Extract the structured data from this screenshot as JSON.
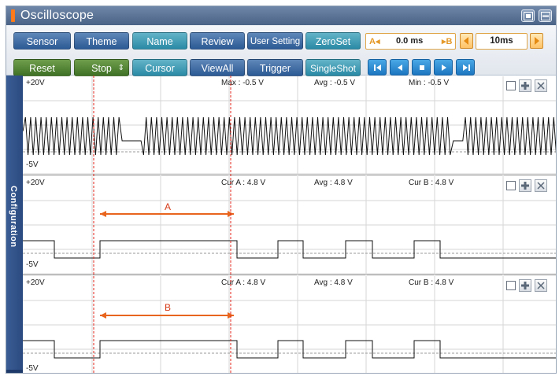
{
  "window": {
    "title": "Oscilloscope"
  },
  "toolbar": {
    "row1": [
      "Sensor",
      "Theme",
      "Name",
      "Review",
      "User Setting",
      "ZeroSet"
    ],
    "row2": [
      "Reset",
      "Stop",
      "Cursor",
      "ViewAll",
      "Trigger",
      "SingleShot"
    ],
    "cursor_a_label": "A",
    "delta_time": "0.0 ms",
    "cursor_b_label": "B",
    "time_div": "10ms"
  },
  "sidebar": {
    "label": "Configuration"
  },
  "panels": [
    {
      "top_label": "+20V",
      "bottom_label": "-5V",
      "stat1": "Max : -0.5 V",
      "stat2": "Avg : -0.5 V",
      "stat3": "Min : -0.5 V"
    },
    {
      "top_label": "+20V",
      "bottom_label": "-5V",
      "stat1": "Cur A : 4.8 V",
      "stat2": "Avg : 4.8 V",
      "stat3": "Cur B : 4.8 V",
      "span_label": "A"
    },
    {
      "top_label": "+20V",
      "bottom_label": "-5V",
      "stat1": "Cur A : 4.8 V",
      "stat2": "Avg : 4.8 V",
      "stat3": "Cur B : 4.8 V",
      "span_label": "B"
    }
  ],
  "colors": {
    "accent": "#ff7a1a",
    "cursor": "#e0241b",
    "span_arrow": "#e8651e"
  },
  "icons": {
    "window_buttons": [
      "restore-icon",
      "minimize-icon"
    ],
    "media": [
      "first-icon",
      "prev-icon",
      "stop-icon",
      "play-icon",
      "last-icon"
    ]
  }
}
